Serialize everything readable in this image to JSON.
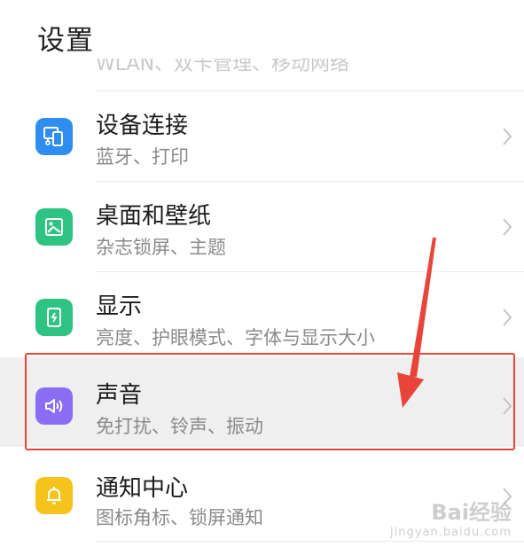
{
  "header": {
    "title": "设置"
  },
  "partial_row": {
    "text": "WLAN、双卡管理、移动网络"
  },
  "rows": [
    {
      "title": "设备连接",
      "subtitle": "蓝牙、打印",
      "icon": "device-connect-icon",
      "icon_color": "#2f8cf0"
    },
    {
      "title": "桌面和壁纸",
      "subtitle": "杂志锁屏、主题",
      "icon": "wallpaper-icon",
      "icon_color": "#2cc480"
    },
    {
      "title": "显示",
      "subtitle": "亮度、护眼模式、字体与显示大小",
      "icon": "display-icon",
      "icon_color": "#2cc480"
    },
    {
      "title": "声音",
      "subtitle": "免打扰、铃声、振动",
      "icon": "sound-icon",
      "icon_color": "#8a6df2"
    },
    {
      "title": "通知中心",
      "subtitle": "图标角标、锁屏通知",
      "icon": "notification-bell-icon",
      "icon_color": "#f6c31c"
    }
  ],
  "annotation": {
    "highlight_color": "#e8443a",
    "arrow_color": "#e8443a"
  },
  "watermark": {
    "logo": "Bai经验",
    "url": "jingyan.baidu.com"
  }
}
